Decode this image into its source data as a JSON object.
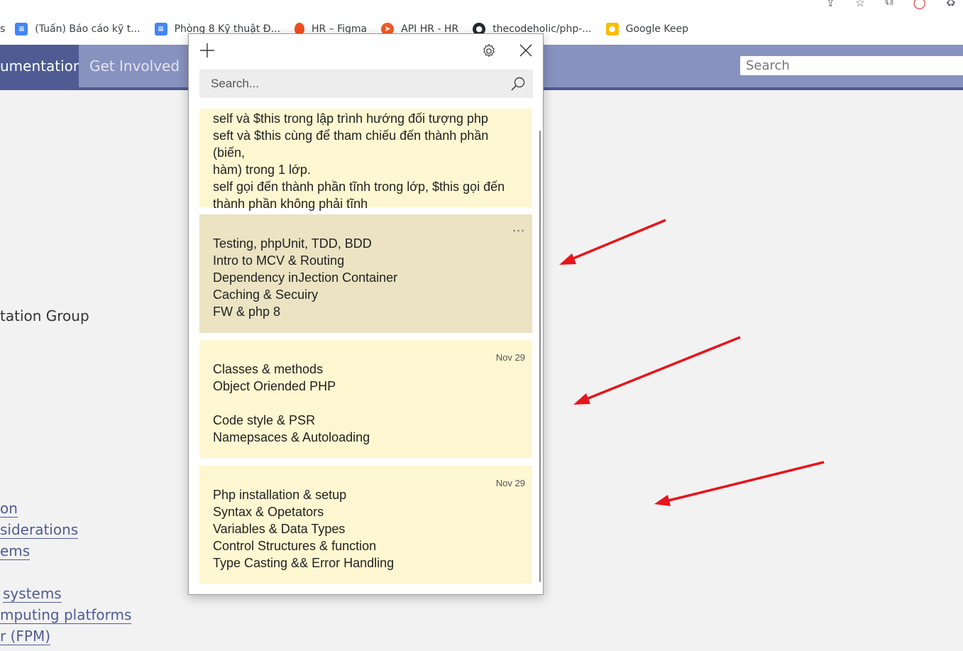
{
  "browser": {
    "bookmarks": [
      {
        "label": "s",
        "icon": "none"
      },
      {
        "label": "(Tuấn) Báo cáo kỹ t...",
        "icon": "google-docs-icon"
      },
      {
        "label": "Phòng 8 Kỹ thuật Đ...",
        "icon": "google-docs-icon"
      },
      {
        "label": "HR – Figma",
        "icon": "figma-icon"
      },
      {
        "label": "API HR - HR",
        "icon": "api-icon"
      },
      {
        "label": "thecodeholic/php-...",
        "icon": "github-icon"
      },
      {
        "label": "Google Keep",
        "icon": "google-keep-icon"
      }
    ]
  },
  "site": {
    "nav_active": "umentation",
    "nav_item": "Get Involved",
    "search_placeholder": "Search",
    "body_text": "tation Group",
    "links": [
      "on",
      "siderations",
      "ems",
      "systems",
      "mputing platforms",
      "r (FPM)"
    ]
  },
  "notes_app": {
    "search_placeholder": "Search...",
    "notes": [
      {
        "date": "",
        "lines": [
          "self và $this trong lập trình hướng đối tượng php",
          "seft và $this cùng để tham chiếu đến thành phần (biến,",
          "hàm) trong 1 lớp.",
          "self gọi đến thành phần tĩnh trong lớp, $this gọi đến",
          "thành phần không phải tĩnh"
        ]
      },
      {
        "date": "",
        "more": "...",
        "lines": [
          "Testing, phpUnit, TDD, BDD",
          "Intro to MCV & Routing",
          "Dependency inJection Container",
          "Caching & Secuiry",
          "FW & php 8"
        ]
      },
      {
        "date": "Nov 29",
        "lines": [
          "Classes & methods",
          "Object Oriended PHP",
          "",
          "Code style & PSR",
          "Namepsaces & Autoloading"
        ]
      },
      {
        "date": "Nov 29",
        "lines": [
          "Php installation & setup",
          "Syntax & Opetators",
          "Variables & Data Types",
          "Control Structures & function",
          "Type Casting && Error Handling"
        ]
      }
    ]
  },
  "colors": {
    "note_bg": "#fff7d1",
    "note_selected_bg": "#ebe3c2",
    "php_nav": "#8892bf",
    "php_nav_dark": "#4f5b93",
    "annotation_arrow": "#e8141b"
  }
}
